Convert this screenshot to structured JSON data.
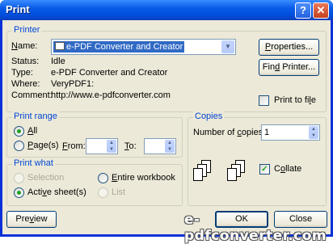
{
  "window": {
    "title": "Print",
    "help_glyph": "?",
    "close_glyph": "✕"
  },
  "printer": {
    "group_title": "Printer",
    "name_label": "Name:",
    "name_value": "e-PDF Converter and Creator",
    "status_label": "Status:",
    "status_value": "Idle",
    "type_label": "Type:",
    "type_value": "e-PDF Converter and Creator",
    "where_label": "Where:",
    "where_value": "VeryPDF1:",
    "comment_label": "Comment:",
    "comment_value": "http://www.e-pdfconverter.com",
    "properties_button": "Properties...",
    "find_printer_button": "Find Printer...",
    "print_to_file_label": "Print to file",
    "print_to_file_checked": false
  },
  "print_range": {
    "group_title": "Print range",
    "all_label": "All",
    "pages_label": "Page(s)",
    "from_label": "From:",
    "to_label": "To:",
    "selected": "all"
  },
  "copies": {
    "group_title": "Copies",
    "number_label": "Number of copies:",
    "number_value": "1",
    "collate_label": "Collate",
    "collate_checked": true
  },
  "print_what": {
    "group_title": "Print what",
    "selection_label": "Selection",
    "entire_workbook_label": "Entire workbook",
    "active_sheets_label": "Active sheet(s)",
    "list_label": "List",
    "selected": "active_sheets"
  },
  "buttons": {
    "preview": "Preview",
    "ok": "OK",
    "close": "Close"
  },
  "watermark": "e-pdfconverter.com",
  "colors": {
    "group_title": "#0046d5",
    "titlebar": "#0a5ce8",
    "radio_dot": "#21a121"
  }
}
